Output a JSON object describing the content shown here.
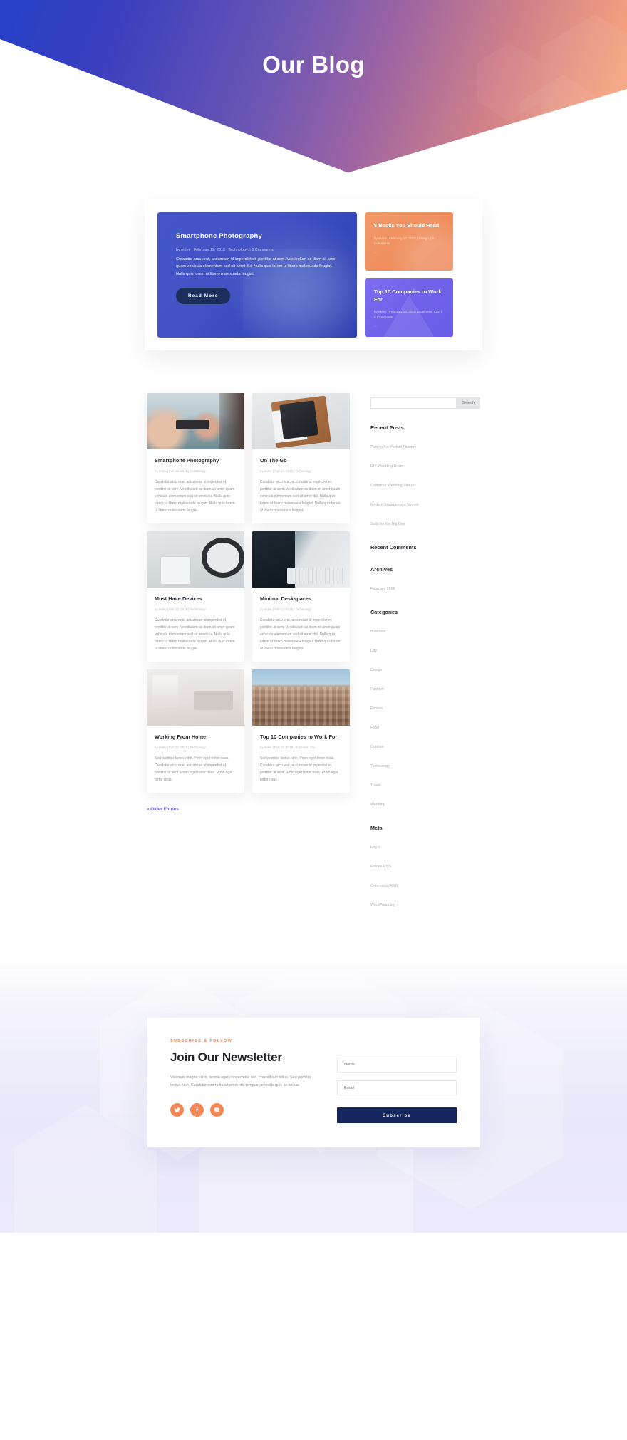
{
  "hero": {
    "title": "Our Blog"
  },
  "featured": {
    "main": {
      "title": "Smartphone Photography",
      "meta": "by etdev | February 12, 2018 | Technology, | 0 Comments",
      "body": "Curabitur arcu erat, accumsan id imperdiet et, porttitor at sem. Vestibulum ac diam sit amet quam vehicula elementum sed sit amet dui. Nulla quis lorem ut libero malesuada feugiat. Nulla quis lorem ut libero malesuada feugiat.",
      "button": "Read More"
    },
    "cards": [
      {
        "title": "6 Books You Should Read",
        "meta": "by etdev | February 12, 2018 | Design, | 0 Comments",
        "dots": "...",
        "color": "#ef8f5e"
      },
      {
        "title": "Top 10 Companies to Work For",
        "meta": "by etdev | February 12, 2018 | Business, City, | 0 Comments",
        "dots": "...",
        "color": "#7063ea"
      }
    ]
  },
  "posts": [
    {
      "title": "Smartphone Photography",
      "meta": "by etdev | Feb 12, 2018 | Technology",
      "excerpt": "Curabitur arcu erat, accumsan id imperdiet et, porttitor at sem. Vestibulum ac diam sit amet quam vehicula elementum sed sit amet dui. Nulla quis lorem ut libero malesuada feugiat. Nulla quis lorem ut libero malesuada feugiat.",
      "thumb": "camera-photo"
    },
    {
      "title": "On The Go",
      "meta": "by etdev | Feb 12, 2018 | Technology",
      "excerpt": "Curabitur arcu erat, accumsan id imperdiet et, porttitor at sem. Vestibulum ac diam sit amet quam vehicula elementum sed sit amet dui. Nulla quis lorem ut libero malesuada feugiat. Nulla quis lorem ut libero malesuada feugiat.",
      "thumb": "tablet-case-photo"
    },
    {
      "title": "Must Have Devices",
      "meta": "by etdev | Feb 12, 2018 | Technology",
      "excerpt": "Curabitur arcu erat, accumsan id imperdiet et, porttitor at sem. Vestibulum ac diam sit amet quam vehicula elementum sed sit amet dui. Nulla quis lorem ut libero malesuada feugiat. Nulla quis lorem ut libero malesuada feugiat.",
      "thumb": "headphones-phone-photo"
    },
    {
      "title": "Minimal Deskspaces",
      "meta": "by etdev | Feb 12, 2018 | Technology",
      "excerpt": "Curabitur arcu erat, accumsan id imperdiet et, porttitor at sem. Vestibulum ac diam sit amet quam vehicula elementum sed sit amet dui. Nulla quis lorem ut libero malesuada feugiat. Nulla quis lorem ut libero malesuada feugiat.",
      "thumb": "keyboard-desk-photo"
    },
    {
      "title": "Working From Home",
      "meta": "by etdev | Feb 12, 2018 | Technology",
      "excerpt": "Sed porttitor lectus nibh. Proin eget tortor risus. Curabitur arcu erat, accumsan id imperdiet et, porttitor at sem. Proin eget tortor risus. Proin eget tortor risus.",
      "thumb": "home-desk-photo"
    },
    {
      "title": "Top 10 Companies to Work For",
      "meta": "by etdev | Feb 12, 2018 | Business, City",
      "excerpt": "Sed porttitor lectus nibh. Proin eget tortor risus. Curabitur arcu erat, accumsan id imperdiet et, porttitor at sem. Proin eget tortor risus. Proin eget tortor risus.",
      "thumb": "building-photo"
    }
  ],
  "pagination": {
    "older": "« Older Entries"
  },
  "sidebar": {
    "search": {
      "value": "",
      "placeholder": "",
      "button": "Search"
    },
    "recent_posts": {
      "title": "Recent Posts",
      "items": [
        "Picking the Perfect Flowers",
        "DIY Wedding Decor",
        "California Wedding Venues",
        "Modern Engagement Shoots",
        "Suits for the Big Day"
      ]
    },
    "recent_comments": {
      "title": "Recent Comments",
      "items": []
    },
    "archives": {
      "title": "Archives",
      "items": [
        "February 2018"
      ]
    },
    "categories": {
      "title": "Categories",
      "items": [
        "Business",
        "City",
        "Design",
        "Fashion",
        "Fitness",
        "Food",
        "Outdoor",
        "Technology",
        "Travel",
        "Wedding"
      ]
    },
    "meta": {
      "title": "Meta",
      "items": [
        "Log in",
        "Entries RSS",
        "Comments RSS",
        "WordPress.org"
      ]
    }
  },
  "newsletter": {
    "eyebrow": "SUBSCRIBE & FOLLOW",
    "heading": "Join Our Newsletter",
    "text": "Vivamus magna justo, lacinia eget consectetur sed, convallis at tellus. Sed porttitor lectus nibh. Curabitur non nulla sit amet nisl tempus convallis quis ac lectus.",
    "socials": [
      "twitter-icon",
      "facebook-icon",
      "youtube-icon"
    ],
    "name_placeholder": "Name",
    "email_placeholder": "Email",
    "submit": "Subscribe",
    "accent": "#f58757"
  }
}
